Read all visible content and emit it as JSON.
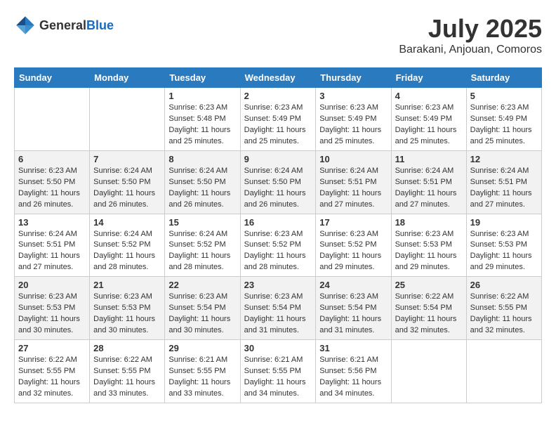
{
  "header": {
    "logo_general": "General",
    "logo_blue": "Blue",
    "title": "July 2025",
    "location": "Barakani, Anjouan, Comoros"
  },
  "weekdays": [
    "Sunday",
    "Monday",
    "Tuesday",
    "Wednesday",
    "Thursday",
    "Friday",
    "Saturday"
  ],
  "weeks": [
    [
      {
        "day": "",
        "info": ""
      },
      {
        "day": "",
        "info": ""
      },
      {
        "day": "1",
        "info": "Sunrise: 6:23 AM\nSunset: 5:48 PM\nDaylight: 11 hours and 25 minutes."
      },
      {
        "day": "2",
        "info": "Sunrise: 6:23 AM\nSunset: 5:49 PM\nDaylight: 11 hours and 25 minutes."
      },
      {
        "day": "3",
        "info": "Sunrise: 6:23 AM\nSunset: 5:49 PM\nDaylight: 11 hours and 25 minutes."
      },
      {
        "day": "4",
        "info": "Sunrise: 6:23 AM\nSunset: 5:49 PM\nDaylight: 11 hours and 25 minutes."
      },
      {
        "day": "5",
        "info": "Sunrise: 6:23 AM\nSunset: 5:49 PM\nDaylight: 11 hours and 25 minutes."
      }
    ],
    [
      {
        "day": "6",
        "info": "Sunrise: 6:23 AM\nSunset: 5:50 PM\nDaylight: 11 hours and 26 minutes."
      },
      {
        "day": "7",
        "info": "Sunrise: 6:24 AM\nSunset: 5:50 PM\nDaylight: 11 hours and 26 minutes."
      },
      {
        "day": "8",
        "info": "Sunrise: 6:24 AM\nSunset: 5:50 PM\nDaylight: 11 hours and 26 minutes."
      },
      {
        "day": "9",
        "info": "Sunrise: 6:24 AM\nSunset: 5:50 PM\nDaylight: 11 hours and 26 minutes."
      },
      {
        "day": "10",
        "info": "Sunrise: 6:24 AM\nSunset: 5:51 PM\nDaylight: 11 hours and 27 minutes."
      },
      {
        "day": "11",
        "info": "Sunrise: 6:24 AM\nSunset: 5:51 PM\nDaylight: 11 hours and 27 minutes."
      },
      {
        "day": "12",
        "info": "Sunrise: 6:24 AM\nSunset: 5:51 PM\nDaylight: 11 hours and 27 minutes."
      }
    ],
    [
      {
        "day": "13",
        "info": "Sunrise: 6:24 AM\nSunset: 5:51 PM\nDaylight: 11 hours and 27 minutes."
      },
      {
        "day": "14",
        "info": "Sunrise: 6:24 AM\nSunset: 5:52 PM\nDaylight: 11 hours and 28 minutes."
      },
      {
        "day": "15",
        "info": "Sunrise: 6:24 AM\nSunset: 5:52 PM\nDaylight: 11 hours and 28 minutes."
      },
      {
        "day": "16",
        "info": "Sunrise: 6:23 AM\nSunset: 5:52 PM\nDaylight: 11 hours and 28 minutes."
      },
      {
        "day": "17",
        "info": "Sunrise: 6:23 AM\nSunset: 5:52 PM\nDaylight: 11 hours and 29 minutes."
      },
      {
        "day": "18",
        "info": "Sunrise: 6:23 AM\nSunset: 5:53 PM\nDaylight: 11 hours and 29 minutes."
      },
      {
        "day": "19",
        "info": "Sunrise: 6:23 AM\nSunset: 5:53 PM\nDaylight: 11 hours and 29 minutes."
      }
    ],
    [
      {
        "day": "20",
        "info": "Sunrise: 6:23 AM\nSunset: 5:53 PM\nDaylight: 11 hours and 30 minutes."
      },
      {
        "day": "21",
        "info": "Sunrise: 6:23 AM\nSunset: 5:53 PM\nDaylight: 11 hours and 30 minutes."
      },
      {
        "day": "22",
        "info": "Sunrise: 6:23 AM\nSunset: 5:54 PM\nDaylight: 11 hours and 30 minutes."
      },
      {
        "day": "23",
        "info": "Sunrise: 6:23 AM\nSunset: 5:54 PM\nDaylight: 11 hours and 31 minutes."
      },
      {
        "day": "24",
        "info": "Sunrise: 6:23 AM\nSunset: 5:54 PM\nDaylight: 11 hours and 31 minutes."
      },
      {
        "day": "25",
        "info": "Sunrise: 6:22 AM\nSunset: 5:54 PM\nDaylight: 11 hours and 32 minutes."
      },
      {
        "day": "26",
        "info": "Sunrise: 6:22 AM\nSunset: 5:55 PM\nDaylight: 11 hours and 32 minutes."
      }
    ],
    [
      {
        "day": "27",
        "info": "Sunrise: 6:22 AM\nSunset: 5:55 PM\nDaylight: 11 hours and 32 minutes."
      },
      {
        "day": "28",
        "info": "Sunrise: 6:22 AM\nSunset: 5:55 PM\nDaylight: 11 hours and 33 minutes."
      },
      {
        "day": "29",
        "info": "Sunrise: 6:21 AM\nSunset: 5:55 PM\nDaylight: 11 hours and 33 minutes."
      },
      {
        "day": "30",
        "info": "Sunrise: 6:21 AM\nSunset: 5:55 PM\nDaylight: 11 hours and 34 minutes."
      },
      {
        "day": "31",
        "info": "Sunrise: 6:21 AM\nSunset: 5:56 PM\nDaylight: 11 hours and 34 minutes."
      },
      {
        "day": "",
        "info": ""
      },
      {
        "day": "",
        "info": ""
      }
    ]
  ]
}
